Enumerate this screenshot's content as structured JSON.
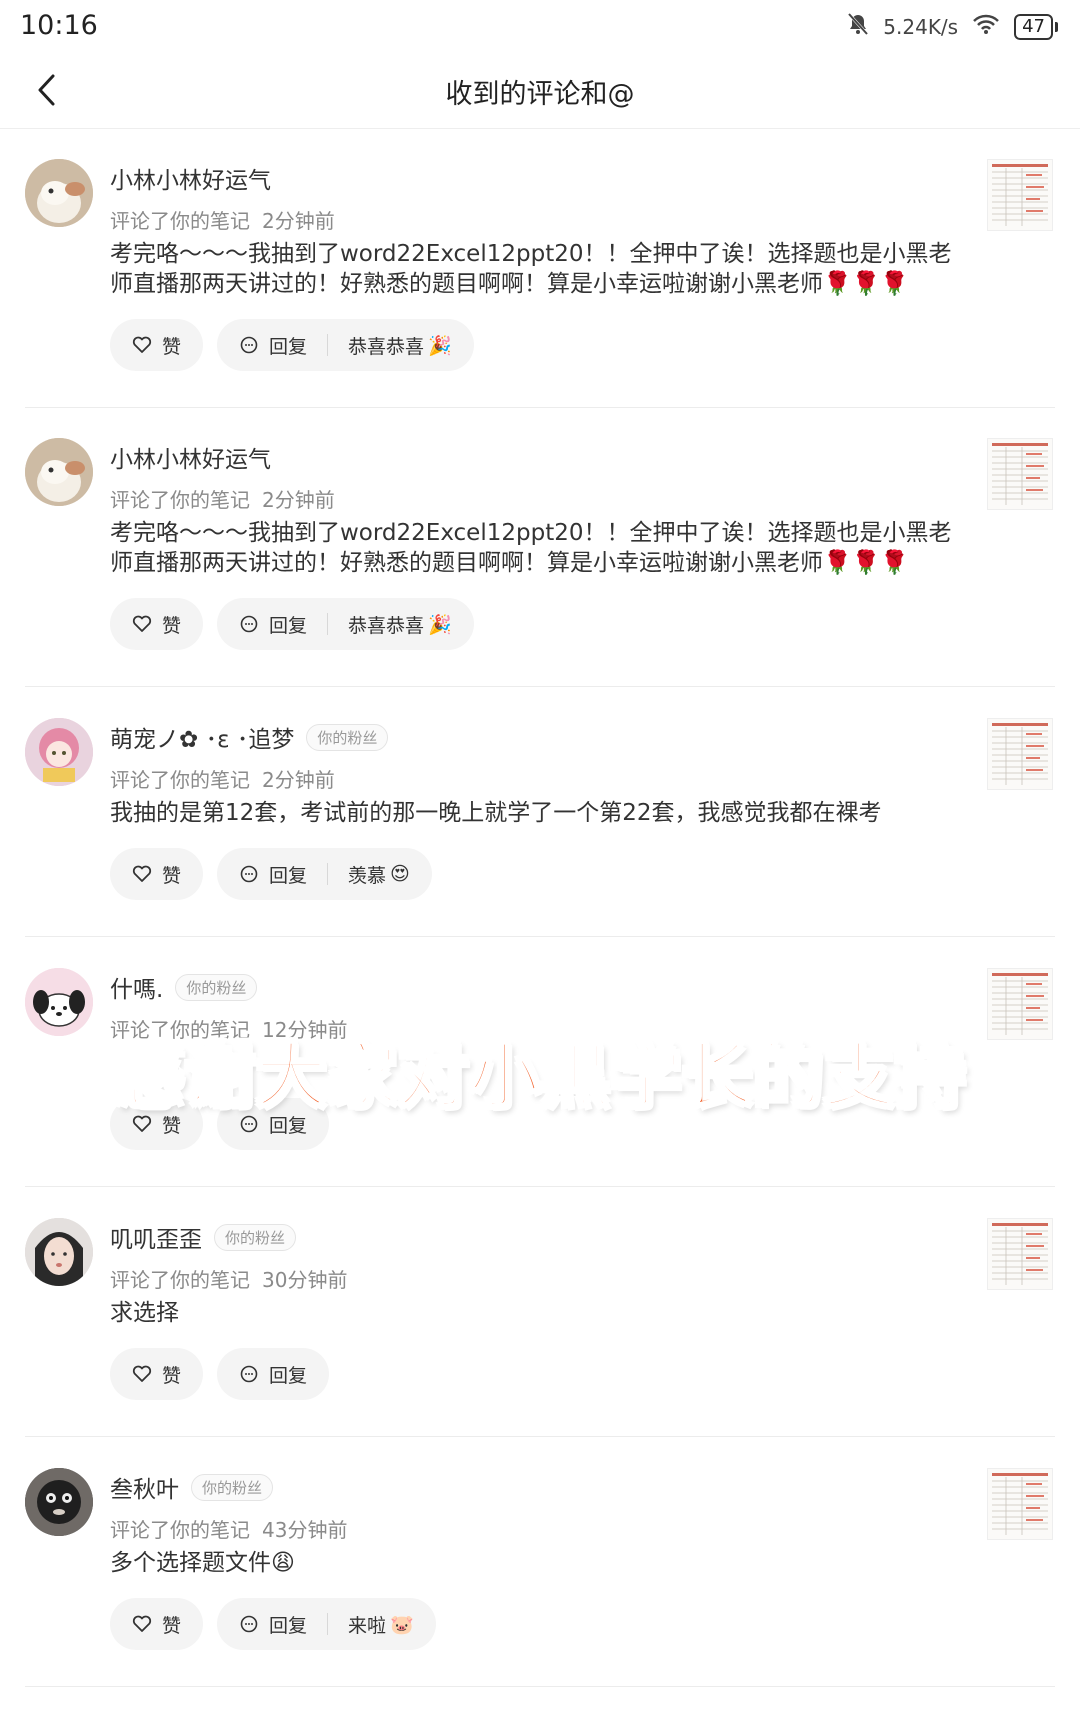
{
  "status_bar": {
    "time": "10:16",
    "net_speed": "5.24K/s",
    "battery": "47"
  },
  "header": {
    "title": "收到的评论和@"
  },
  "labels": {
    "like": "赞",
    "reply": "回复",
    "fan_badge": "你的粉丝"
  },
  "comments": [
    {
      "username": "小林小林好运气",
      "action": "评论了你的笔记",
      "time": "2分钟前",
      "fan": false,
      "text": "考完咯～～～我抽到了word22Excel12ppt20！！全押中了诶！选择题也是小黑老师直播那两天讲过的！好熟悉的题目啊啊！算是小幸运啦谢谢小黑老师🌹🌹🌹",
      "quick_reply": "恭喜恭喜",
      "quick_emoji": "🎉"
    },
    {
      "username": "小林小林好运气",
      "action": "评论了你的笔记",
      "time": "2分钟前",
      "fan": false,
      "text": "考完咯～～～我抽到了word22Excel12ppt20！！全押中了诶！选择题也是小黑老师直播那两天讲过的！好熟悉的题目啊啊！算是小幸运啦谢谢小黑老师🌹🌹🌹",
      "quick_reply": "恭喜恭喜",
      "quick_emoji": "🎉"
    },
    {
      "username": "萌宠ノ✿ ･ε ･追梦",
      "action": "评论了你的笔记",
      "time": "2分钟前",
      "fan": true,
      "text": "我抽的是第12套，考试前的那一晚上就学了一个第22套，我感觉我都在裸考",
      "quick_reply": "羡慕",
      "quick_emoji": "😍"
    },
    {
      "username": "什嗎.",
      "action": "评论了你的笔记",
      "time": "12分钟前",
      "fan": true,
      "text": "",
      "quick_reply": "",
      "quick_emoji": ""
    },
    {
      "username": "叽叽歪歪",
      "action": "评论了你的笔记",
      "time": "30分钟前",
      "fan": true,
      "text": "求选择",
      "quick_reply": "",
      "quick_emoji": ""
    },
    {
      "username": "叁秋叶",
      "action": "评论了你的笔记",
      "time": "43分钟前",
      "fan": true,
      "text": "多个选择题文件😩",
      "quick_reply": "来啦",
      "quick_emoji": "🐷"
    }
  ],
  "overlay_banner": "感谢大家对小黑学长的支持",
  "colors": {
    "banner": "#f2612a",
    "avatar_bg": [
      "#d9cbb8",
      "#d9cbb8",
      "#e8c7d5",
      "#f3d7e0",
      "#d9d2cf",
      "#3a3a3a"
    ]
  }
}
